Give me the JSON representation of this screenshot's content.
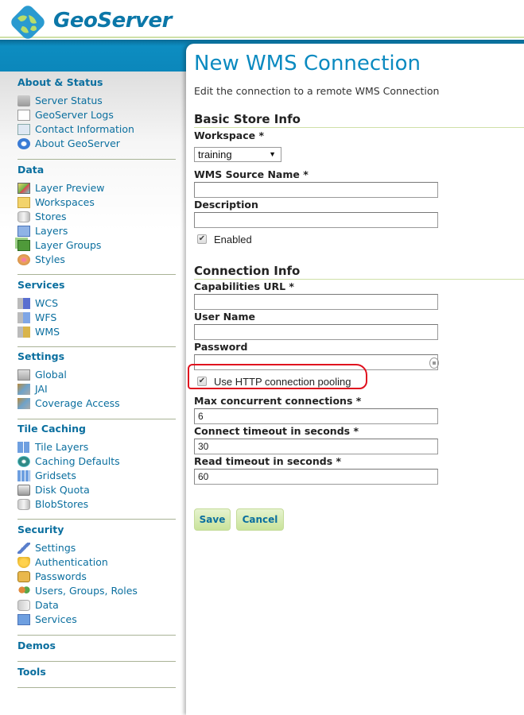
{
  "header": {
    "app_name": "GeoServer",
    "logo_icon": "globe-logo-icon"
  },
  "sidebar": {
    "sections": [
      {
        "title": "About & Status",
        "items": [
          {
            "label": "Server Status",
            "icon": "server-warning-icon"
          },
          {
            "label": "GeoServer Logs",
            "icon": "document-icon"
          },
          {
            "label": "Contact Information",
            "icon": "contact-card-icon"
          },
          {
            "label": "About GeoServer",
            "icon": "help-icon"
          }
        ]
      },
      {
        "title": "Data",
        "items": [
          {
            "label": "Layer Preview",
            "icon": "map-preview-icon"
          },
          {
            "label": "Workspaces",
            "icon": "folder-icon"
          },
          {
            "label": "Stores",
            "icon": "database-icon"
          },
          {
            "label": "Layers",
            "icon": "layer-icon"
          },
          {
            "label": "Layer Groups",
            "icon": "layer-group-icon"
          },
          {
            "label": "Styles",
            "icon": "palette-icon"
          }
        ]
      },
      {
        "title": "Services",
        "items": [
          {
            "label": "WCS",
            "icon": "wcs-service-icon"
          },
          {
            "label": "WFS",
            "icon": "wfs-service-icon"
          },
          {
            "label": "WMS",
            "icon": "wms-service-icon"
          }
        ]
      },
      {
        "title": "Settings",
        "items": [
          {
            "label": "Global",
            "icon": "server-icon"
          },
          {
            "label": "JAI",
            "icon": "image-settings-icon"
          },
          {
            "label": "Coverage Access",
            "icon": "image-settings-icon"
          }
        ]
      },
      {
        "title": "Tile Caching",
        "items": [
          {
            "label": "Tile Layers",
            "icon": "tiles-icon"
          },
          {
            "label": "Caching Defaults",
            "icon": "globe-grid-icon"
          },
          {
            "label": "Gridsets",
            "icon": "grid-icon"
          },
          {
            "label": "Disk Quota",
            "icon": "disk-icon"
          },
          {
            "label": "BlobStores",
            "icon": "database-icon"
          }
        ]
      },
      {
        "title": "Security",
        "items": [
          {
            "label": "Settings",
            "icon": "wrench-icon"
          },
          {
            "label": "Authentication",
            "icon": "shield-icon"
          },
          {
            "label": "Passwords",
            "icon": "lock-icon"
          },
          {
            "label": "Users, Groups, Roles",
            "icon": "users-icon"
          },
          {
            "label": "Data",
            "icon": "database-key-icon"
          },
          {
            "label": "Services",
            "icon": "service-key-icon"
          }
        ]
      },
      {
        "title": "Demos",
        "items": []
      },
      {
        "title": "Tools",
        "items": []
      }
    ]
  },
  "main": {
    "title": "New WMS Connection",
    "description": "Edit the connection to a remote WMS Connection",
    "basic_section": {
      "heading": "Basic Store Info",
      "workspace_label": "Workspace *",
      "workspace_value": "training",
      "source_name_label": "WMS Source Name *",
      "source_name_value": "",
      "description_label": "Description",
      "description_value": "",
      "enabled_label": "Enabled",
      "enabled_checked": true
    },
    "connection_section": {
      "heading": "Connection Info",
      "capabilities_label": "Capabilities URL *",
      "capabilities_value": "",
      "username_label": "User Name",
      "username_value": "",
      "password_label": "Password",
      "password_value": "",
      "pooling_label": "Use HTTP connection pooling",
      "pooling_checked": true,
      "max_conn_label": "Max concurrent connections *",
      "max_conn_value": "6",
      "connect_timeout_label": "Connect timeout in seconds *",
      "connect_timeout_value": "30",
      "read_timeout_label": "Read timeout in seconds *",
      "read_timeout_value": "60"
    },
    "buttons": {
      "save": "Save",
      "cancel": "Cancel"
    },
    "annotation_color": "#e0101e"
  },
  "colors": {
    "brand_blue": "#0b87bb",
    "link": "#0b6f9f",
    "title": "#0b8ac0",
    "button_green": "#c9e39a"
  }
}
